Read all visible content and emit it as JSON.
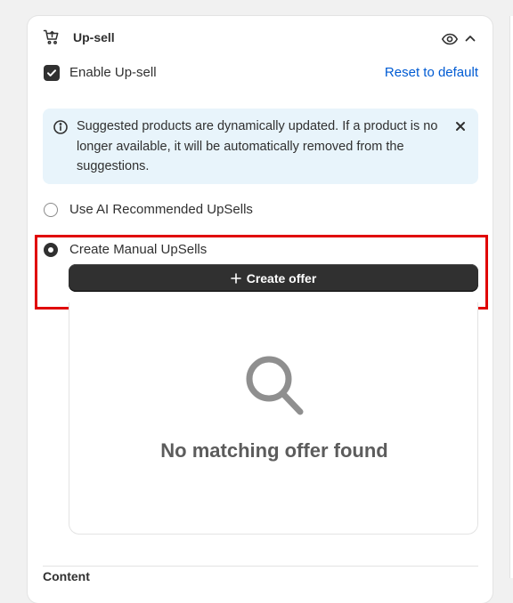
{
  "header": {
    "title": "Up-sell",
    "icon": "cart-upsell-icon"
  },
  "enable": {
    "label": "Enable Up-sell",
    "checked": true,
    "reset_label": "Reset to default"
  },
  "banner": {
    "text": "Suggested products are dynamically updated. If a product is no longer available, it will be automatically removed from the suggestions.",
    "icon": "info-icon"
  },
  "options": {
    "ai_label": "Use AI Recommended UpSells",
    "manual_label": "Create Manual UpSells",
    "selected": "manual"
  },
  "create_button": {
    "label": "Create offer"
  },
  "empty_state": {
    "text": "No matching offer found",
    "icon": "search-icon"
  },
  "next_section": {
    "title": "Content"
  },
  "colors": {
    "link": "#005bd3",
    "banner_bg": "#e8f4fb",
    "button_bg": "#303030",
    "highlight": "#e00000"
  }
}
